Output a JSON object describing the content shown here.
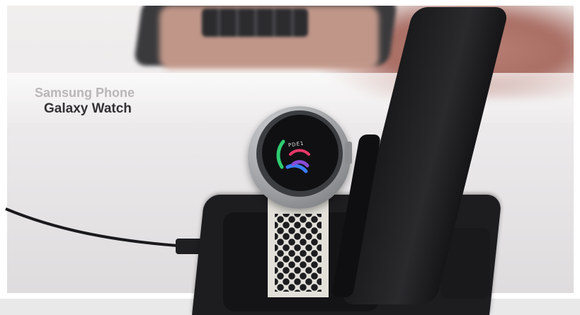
{
  "overlay": {
    "line1": "Samsung Phone",
    "line2": "Galaxy Watch"
  },
  "watch": {
    "display_text": "PDE1"
  },
  "colors": {
    "caption_primary": "#323133",
    "caption_secondary": "#b9b7b8",
    "ring_green": "#2ecc71",
    "ring_blue": "#3b7dff",
    "ring_pink": "#e8386a",
    "ring_purple": "#8a4bd6"
  }
}
